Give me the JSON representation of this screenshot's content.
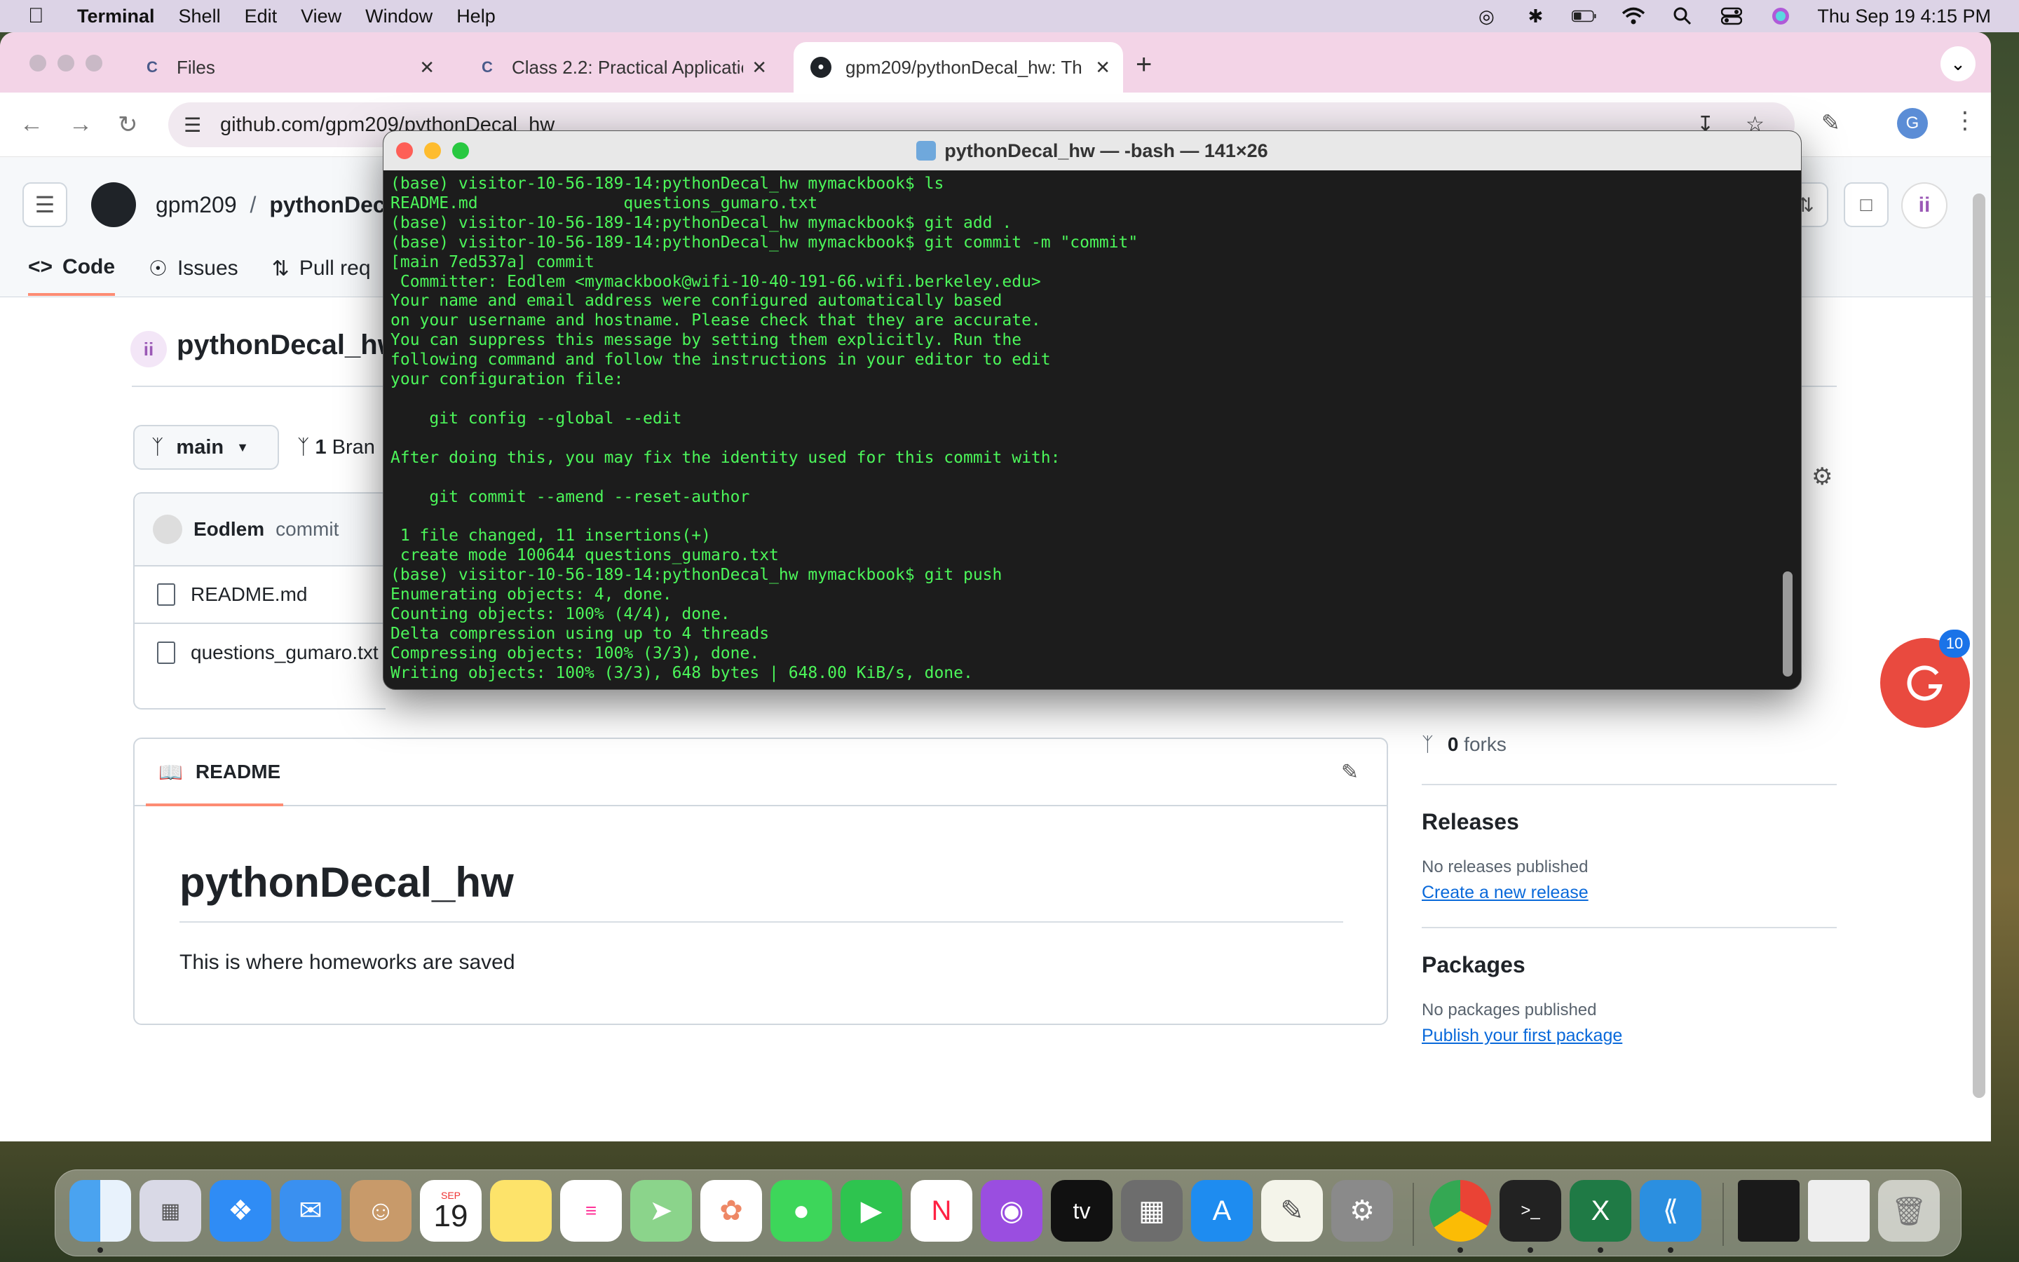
{
  "menubar": {
    "app": "Terminal",
    "items": [
      "Shell",
      "Edit",
      "View",
      "Window",
      "Help"
    ],
    "clock": "Thu Sep 19  4:15 PM"
  },
  "browser": {
    "tabs": [
      {
        "label": "Files"
      },
      {
        "label": "Class 2.2: Practical Applicatio"
      },
      {
        "label": "gpm209/pythonDecal_hw: Th"
      }
    ],
    "url": "github.com/gpm209/pythonDecal_hw",
    "profile_initial": "G"
  },
  "github": {
    "owner": "gpm209",
    "repo_short": "pythonDecal",
    "tabs": [
      "Code",
      "Issues",
      "Pull req"
    ],
    "repo_title": "pythonDecal_hw",
    "branch": "main",
    "branches_count": "1",
    "branches_label": "Bran",
    "commit_author": "Eodlem",
    "commit_msg": "commit",
    "files": [
      "README.md",
      "questions_gumaro.txt"
    ],
    "readme_label": "README",
    "readme_title": "pythonDecal_hw",
    "readme_text": "This is where homeworks are saved",
    "forks_count": "0",
    "forks_label": "forks",
    "releases_title": "Releases",
    "releases_none": "No releases published",
    "releases_link": "Create a new release",
    "packages_title": "Packages",
    "packages_none": "No packages published",
    "packages_link": "Publish your first package"
  },
  "terminal": {
    "title": "pythonDecal_hw — -bash — 141×26",
    "lines": [
      "(base) visitor-10-56-189-14:pythonDecal_hw mymackbook$ ls",
      "README.md               questions_gumaro.txt",
      "(base) visitor-10-56-189-14:pythonDecal_hw mymackbook$ git add .",
      "(base) visitor-10-56-189-14:pythonDecal_hw mymackbook$ git commit -m \"commit\"",
      "[main 7ed537a] commit",
      " Committer: Eodlem <mymackbook@wifi-10-40-191-66.wifi.berkeley.edu>",
      "Your name and email address were configured automatically based",
      "on your username and hostname. Please check that they are accurate.",
      "You can suppress this message by setting them explicitly. Run the",
      "following command and follow the instructions in your editor to edit",
      "your configuration file:",
      "",
      "    git config --global --edit",
      "",
      "After doing this, you may fix the identity used for this commit with:",
      "",
      "    git commit --amend --reset-author",
      "",
      " 1 file changed, 11 insertions(+)",
      " create mode 100644 questions_gumaro.txt",
      "(base) visitor-10-56-189-14:pythonDecal_hw mymackbook$ git push",
      "Enumerating objects: 4, done.",
      "Counting objects: 100% (4/4), done.",
      "Delta compression using up to 4 threads",
      "Compressing objects: 100% (3/3), done.",
      "Writing objects: 100% (3/3), 648 bytes | 648.00 KiB/s, done."
    ]
  },
  "floating_badge": "10",
  "dock": {
    "calendar_month": "SEP",
    "calendar_day": "19",
    "tv_label": "tv"
  }
}
